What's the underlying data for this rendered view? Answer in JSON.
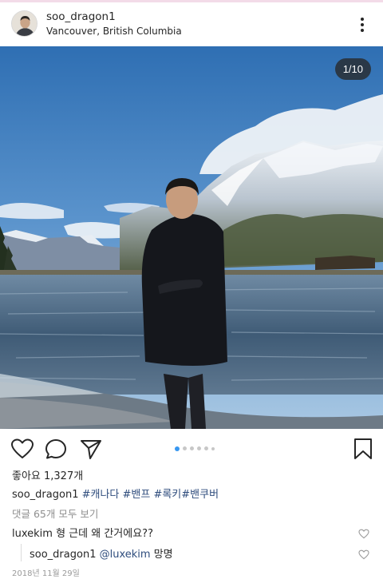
{
  "post": {
    "username": "soo_dragon1",
    "location": "Vancouver, British Columbia",
    "photo_counter": "1/10",
    "likes": "좋아요 1,327개",
    "caption_user": "soo_dragon1",
    "caption_tags": "#캐나다 #밴프 #록키#밴쿠버",
    "view_comments": "댓글 65개 모두 보기",
    "date": "2018년 11월 29일"
  },
  "comments": [
    {
      "user": "luxekim",
      "text": "형 근데 왜 간거에요??"
    },
    {
      "user": "soo_dragon1",
      "mention": "@luxekim",
      "text": "망명"
    }
  ],
  "carousel": {
    "total": 6,
    "active_index": 0
  },
  "colors": {
    "link": "#2f4d7d",
    "active_dot": "#3897f0",
    "muted": "#8e8e8e"
  },
  "icons": [
    "more-options-icon",
    "heart-icon",
    "comment-icon",
    "share-icon",
    "bookmark-icon"
  ]
}
